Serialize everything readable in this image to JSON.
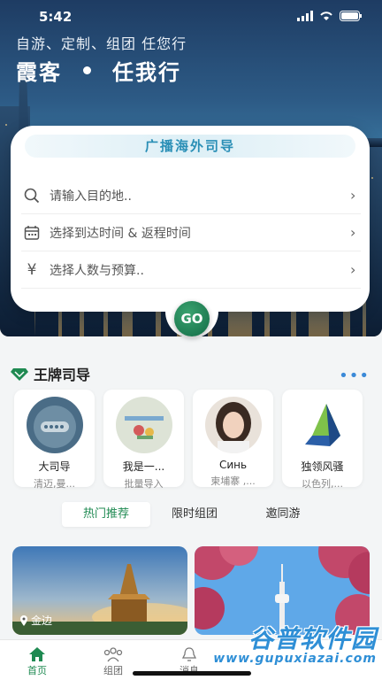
{
  "status": {
    "time": "5:42"
  },
  "hero": {
    "subtitle": "自游、定制、组团 任您行",
    "title_left": "霞客",
    "title_right": "任我行"
  },
  "search": {
    "title": "广播海外司导",
    "rows": [
      {
        "icon": "search-icon",
        "text": "请输入目的地.."
      },
      {
        "icon": "calendar-icon",
        "text": "选择到达时间 & 返程时间"
      },
      {
        "icon": "yen-icon",
        "text": "选择人数与预算.."
      }
    ],
    "go_label": "GO"
  },
  "section": {
    "title": "王牌司导",
    "more": "•••"
  },
  "guides": [
    {
      "name": "大司导",
      "sub": "清迈,曼..."
    },
    {
      "name": "我是一...",
      "sub": "批量导入"
    },
    {
      "name": "Синь",
      "sub": "柬埔寨 ,..."
    },
    {
      "name": "独领风骚",
      "sub": "以色列,..."
    }
  ],
  "tabs": [
    {
      "label": "热门推荐",
      "active": true
    },
    {
      "label": "限时组团",
      "active": false
    },
    {
      "label": "邀同游",
      "active": false
    }
  ],
  "photos": [
    {
      "location": "金边"
    },
    {
      "location": ""
    }
  ],
  "bottom_nav": [
    {
      "label": "首页",
      "icon": "home-icon",
      "active": true
    },
    {
      "label": "组团",
      "icon": "group-icon",
      "active": false
    },
    {
      "label": "消息",
      "icon": "bell-icon",
      "active": false
    }
  ],
  "watermark": {
    "line1": "谷普软件园",
    "line2": "www.gupuxiazai.com"
  },
  "colors": {
    "brand_green": "#1f8a52",
    "accent_blue": "#2a8fb6"
  }
}
